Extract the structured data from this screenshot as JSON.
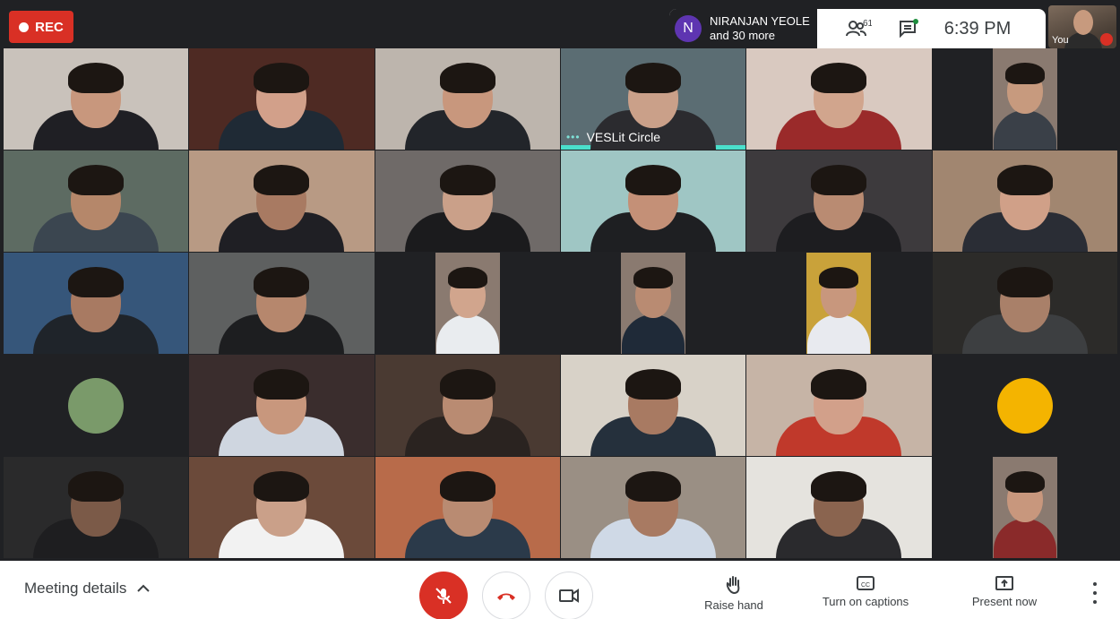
{
  "recording": {
    "label": "REC",
    "color": "#d93025"
  },
  "presenter": {
    "initial": "N",
    "name": "NIRANJAN YEOLE",
    "more": "and 30 more",
    "avatar_color": "#5e35b1"
  },
  "people_button": {
    "icon": "people-icon",
    "count": "61"
  },
  "chat_button": {
    "icon": "chat-icon"
  },
  "clock": "6:39 PM",
  "self_view": {
    "label": "You",
    "mic_state": "muted"
  },
  "active_speaker_label": "VESLit Circle",
  "tiles": [
    {
      "bg": "#c9c2bb",
      "shirt": "#1f1f24",
      "skin": "#c8977d"
    },
    {
      "bg": "#4e2a23",
      "shirt": "#1f2a35",
      "skin": "#d2a08a"
    },
    {
      "bg": "#bdb5ad",
      "shirt": "#22252a",
      "skin": "#c8977d"
    },
    {
      "bg": "#5b6d73",
      "shirt": "#2b2b2f",
      "skin": "#caa089",
      "active": true
    },
    {
      "bg": "#d9c9c0",
      "shirt": "#9a2a2a",
      "skin": "#d1a58d"
    },
    {
      "bg": "#202124",
      "shirt": "#3a4048",
      "skin": "#c79a7e",
      "narrow": true
    },
    {
      "bg": "#5d6b62",
      "shirt": "#3b4650",
      "skin": "#b5876a"
    },
    {
      "bg": "#b89a84",
      "shirt": "#1f1f24",
      "skin": "#a87a62"
    },
    {
      "bg": "#6f6a68",
      "shirt": "#1b1b1d",
      "skin": "#caa089"
    },
    {
      "bg": "#9fc6c4",
      "shirt": "#1e1f22",
      "skin": "#c49077"
    },
    {
      "bg": "#3d3a3d",
      "shirt": "#1d1d20",
      "skin": "#b98b72"
    },
    {
      "bg": "#a18670",
      "shirt": "#2a2d35",
      "skin": "#d0a088"
    },
    {
      "bg": "#36567a",
      "shirt": "#1f242a",
      "skin": "#a87a62"
    },
    {
      "bg": "#5e6060",
      "shirt": "#1d1e20",
      "skin": "#b6876d"
    },
    {
      "bg": "#202124",
      "shirt": "#e9ecef",
      "skin": "#d1a58d",
      "narrow": true
    },
    {
      "bg": "#202124",
      "shirt": "#1f2a38",
      "skin": "#b98b72",
      "narrow": true
    },
    {
      "bg": "#202124",
      "shirt": "#e8eaef",
      "skin": "#c8977d",
      "narrow": true
    },
    {
      "bg": "#2c2b29",
      "shirt": "#3d3f41",
      "skin": "#a98069"
    },
    {
      "bg": "#202124",
      "circle": "#7a9a6a"
    },
    {
      "bg": "#3a2d2d",
      "shirt": "#cfd6e0",
      "skin": "#c8977d"
    },
    {
      "bg": "#4a3a32",
      "shirt": "#2a2320",
      "skin": "#b98b72"
    },
    {
      "bg": "#d8d2c8",
      "shirt": "#25303c",
      "skin": "#a87a62"
    },
    {
      "bg": "#c6b4a6",
      "shirt": "#c0392b",
      "skin": "#d2a08a"
    },
    {
      "bg": "#202124",
      "circle": "#f4b400"
    },
    {
      "bg": "#2a2a2b",
      "shirt": "#1e1e20",
      "skin": "#7b5a48"
    },
    {
      "bg": "#6b4a3a",
      "shirt": "#f2f2f2",
      "skin": "#caa089"
    },
    {
      "bg": "#b86b4a",
      "shirt": "#2b3a4a",
      "skin": "#b98b72"
    },
    {
      "bg": "#9a8f84",
      "shirt": "#cfd9e6",
      "skin": "#a87a62"
    },
    {
      "bg": "#e5e3de",
      "shirt": "#2a2a2d",
      "skin": "#8a644f"
    },
    {
      "bg": "#202124",
      "shirt": "#8a2a2a",
      "skin": "#c8977d",
      "narrow": true
    }
  ],
  "bottom": {
    "meeting_details": "Meeting details",
    "raise_hand": "Raise hand",
    "captions": "Turn on captions",
    "present": "Present now"
  }
}
